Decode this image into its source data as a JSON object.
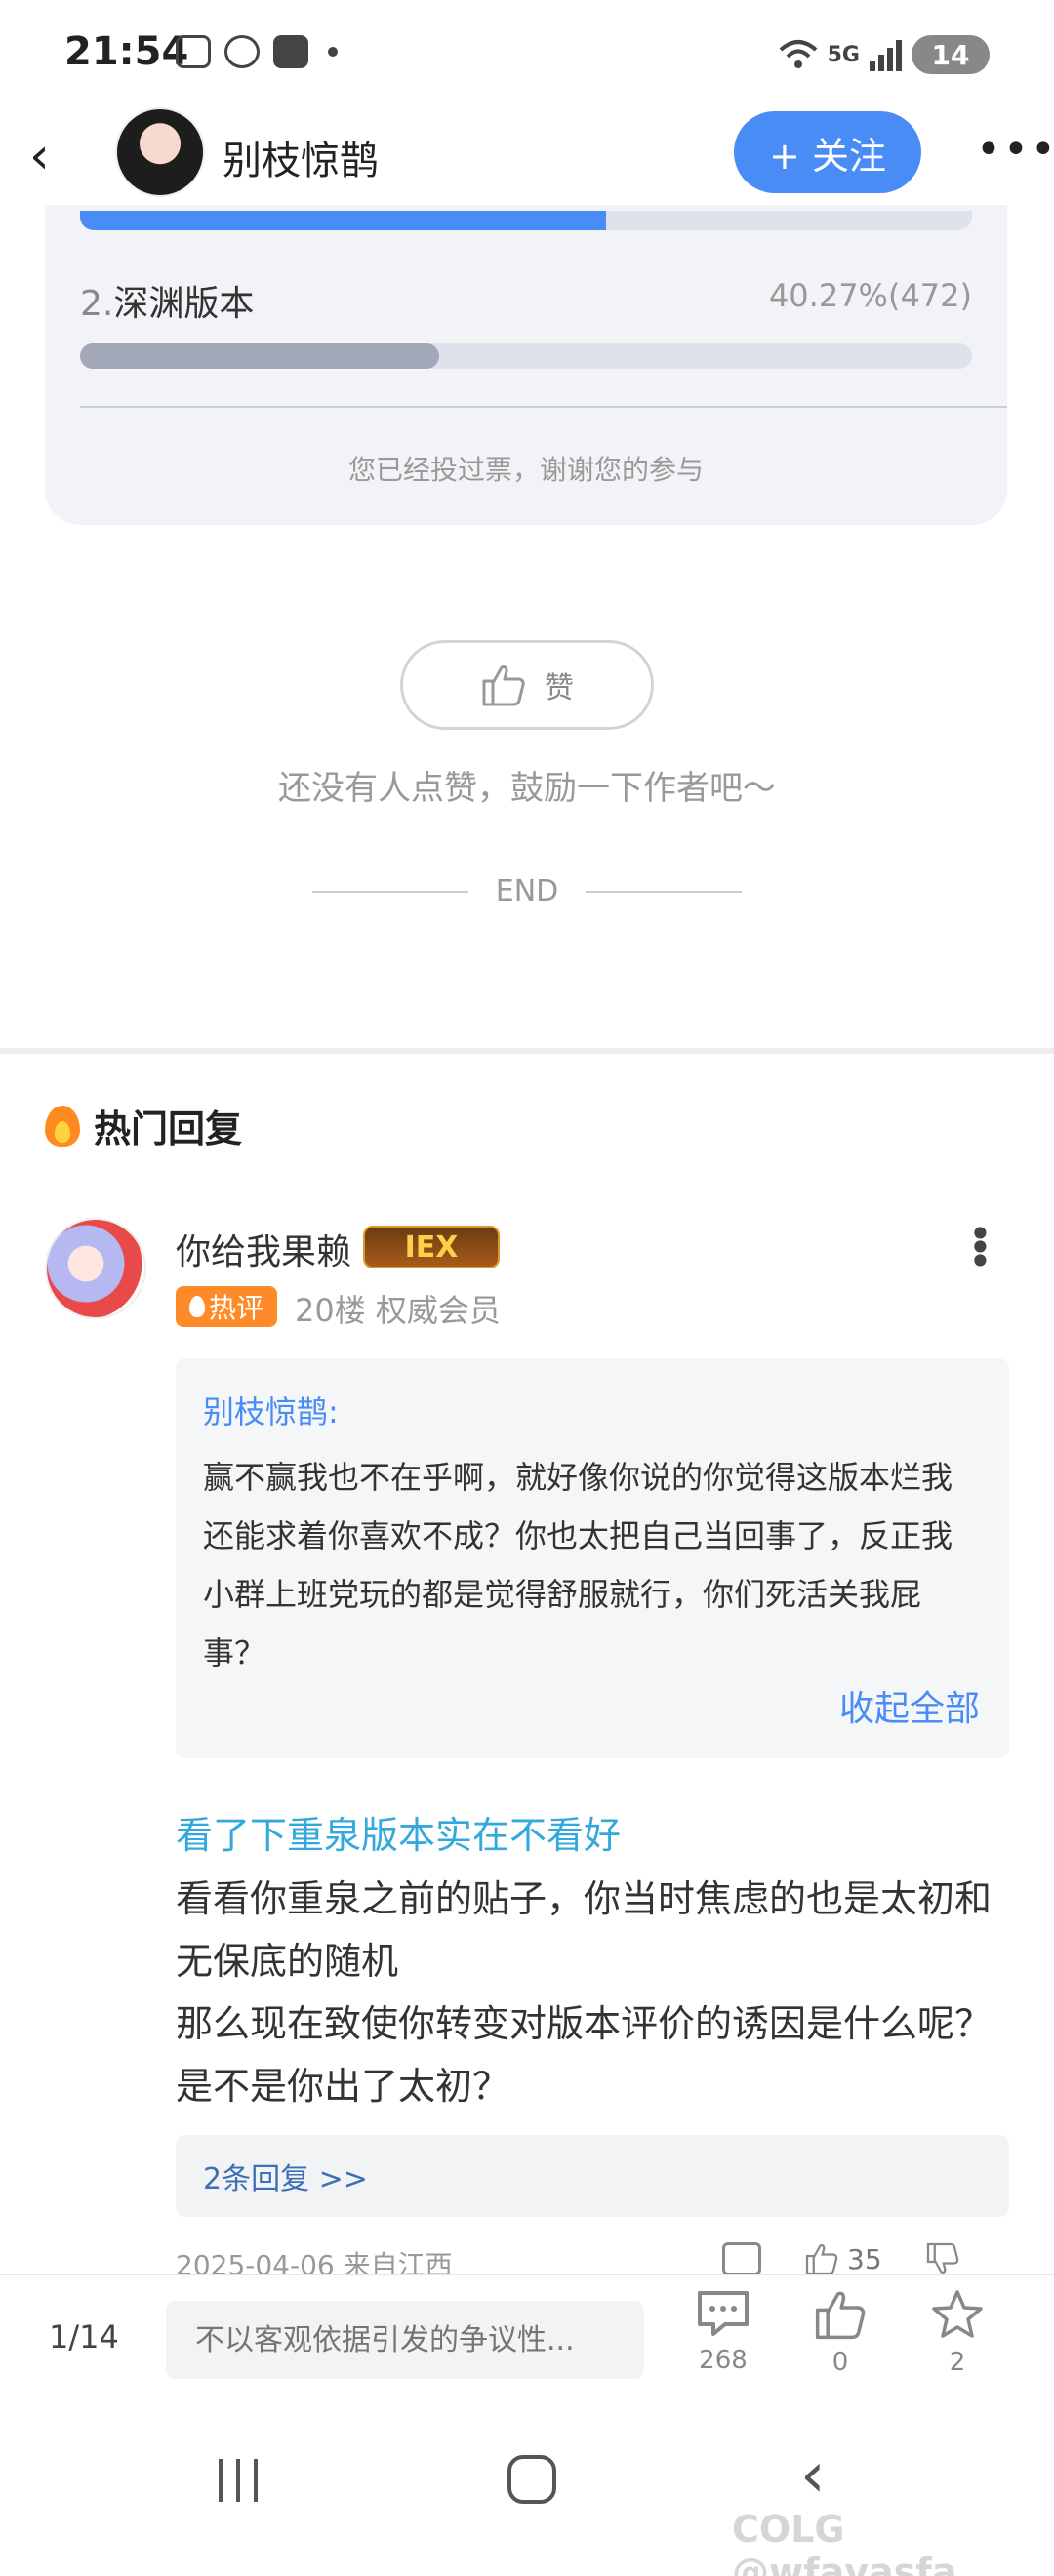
{
  "status_bar": {
    "time": "21:54",
    "network": "5G",
    "battery": "14"
  },
  "header": {
    "back_glyph": "‹",
    "username": "别枝惊鹊",
    "follow_label": "+ 关注",
    "more_glyph": "•••"
  },
  "poll": {
    "options": [
      {
        "label_num": "",
        "label_text": "",
        "percent_text": "",
        "fraction": 0.59,
        "color": "#4a8cf6"
      },
      {
        "label_num": "2.",
        "label_text": "深渊版本",
        "percent_text": "40.27%(472)",
        "fraction": 0.4027,
        "color": "#a3a8b9"
      }
    ],
    "note": "您已经投过票，谢谢您的参与"
  },
  "like": {
    "label": "赞",
    "tip": "还没有人点赞，鼓励一下作者吧～"
  },
  "end_label": "END",
  "hot_replies": {
    "title": "热门回复",
    "comment": {
      "username": "你给我果赖",
      "level_badge": "IEX",
      "hot_badge": "热评",
      "meta": "20楼 权威会员",
      "quote_author": "别枝惊鹊:",
      "quote_text": "赢不赢我也不在乎啊，就好像你说的你觉得这版本烂我还能求着你喜欢不成？你也太把自己当回事了，反正我小群上班党玩的都是觉得舒服就行，你们死活关我屁事？",
      "collapse_label": "收起全部",
      "title": "看了下重泉版本实在不看好",
      "body_line1": "看看你重泉之前的贴子，你当时焦虑的也是太初和无保底的随机",
      "body_line2": "那么现在致使你转变对版本评价的诱因是什么呢？是不是你出了太初？",
      "replies_label": "2条回复 >>",
      "date": "2025-04-06 来自江西",
      "like_count": "35"
    }
  },
  "bottom_bar": {
    "page": "1/14",
    "input_placeholder": "不以客观依据引发的争议性...",
    "comment_count": "268",
    "like_count": "0",
    "fav_count": "2"
  },
  "watermark": "COLG @wfavasfa"
}
